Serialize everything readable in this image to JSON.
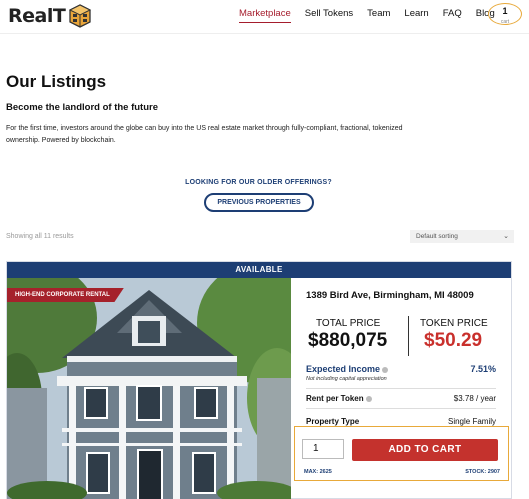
{
  "brand": {
    "name": "RealT"
  },
  "nav": {
    "items": [
      "Marketplace",
      "Sell Tokens",
      "Team",
      "Learn",
      "FAQ",
      "Blog"
    ],
    "active": "Marketplace"
  },
  "cart": {
    "count": "1",
    "caption": "cart"
  },
  "page": {
    "title": "Our Listings",
    "subtitle": "Become the landlord of the future",
    "description": "For the first time, investors around the globe can buy into the US real estate market through fully-compliant, fractional, tokenized ownership. Powered by blockchain.",
    "older_prompt": "LOOKING FOR OUR OLDER OFFERINGS?",
    "previous_button": "PREVIOUS PROPERTIES",
    "results_text": "Showing all 11 results",
    "sort_value": "Default sorting"
  },
  "listing": {
    "status": "AVAILABLE",
    "tag": "HIGH-END CORPORATE RENTAL",
    "address": "1389 Bird Ave, Birmingham, MI 48009",
    "total_price_label": "TOTAL PRICE",
    "total_price": "$880,075",
    "token_price_label": "TOKEN PRICE",
    "token_price": "$50.29",
    "expected_income_label": "Expected Income",
    "expected_income": "7.51%",
    "expected_income_note": "Not including capital appreciation",
    "rent_label": "Rent per Token",
    "rent_value": "$3.78 / year",
    "property_type_label": "Property Type",
    "property_type": "Single Family",
    "quantity": "1",
    "add_to_cart": "ADD TO CART",
    "max_text": "MAX: 2625",
    "stock_text": "STOCK: 2907"
  },
  "colors": {
    "navy": "#1d3e74",
    "red": "#c4322d",
    "accent": "#e8a93a"
  }
}
